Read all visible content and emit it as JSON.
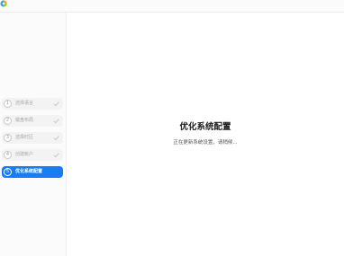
{
  "app": {
    "logo_icon": "installer-logo-icon"
  },
  "sidebar": {
    "steps": [
      {
        "number": "1",
        "label": "选择语言",
        "state": "done"
      },
      {
        "number": "2",
        "label": "键盘布局",
        "state": "done"
      },
      {
        "number": "3",
        "label": "选择时区",
        "state": "done"
      },
      {
        "number": "4",
        "label": "创建帐户",
        "state": "done"
      },
      {
        "number": "5",
        "label": "优化系统配置",
        "state": "active"
      }
    ],
    "accent_color": "#1a7cf5",
    "check_icon": "checkmark-icon"
  },
  "main": {
    "title": "优化系统配置",
    "subtitle": "正在更新系统设置，请稍候..."
  }
}
